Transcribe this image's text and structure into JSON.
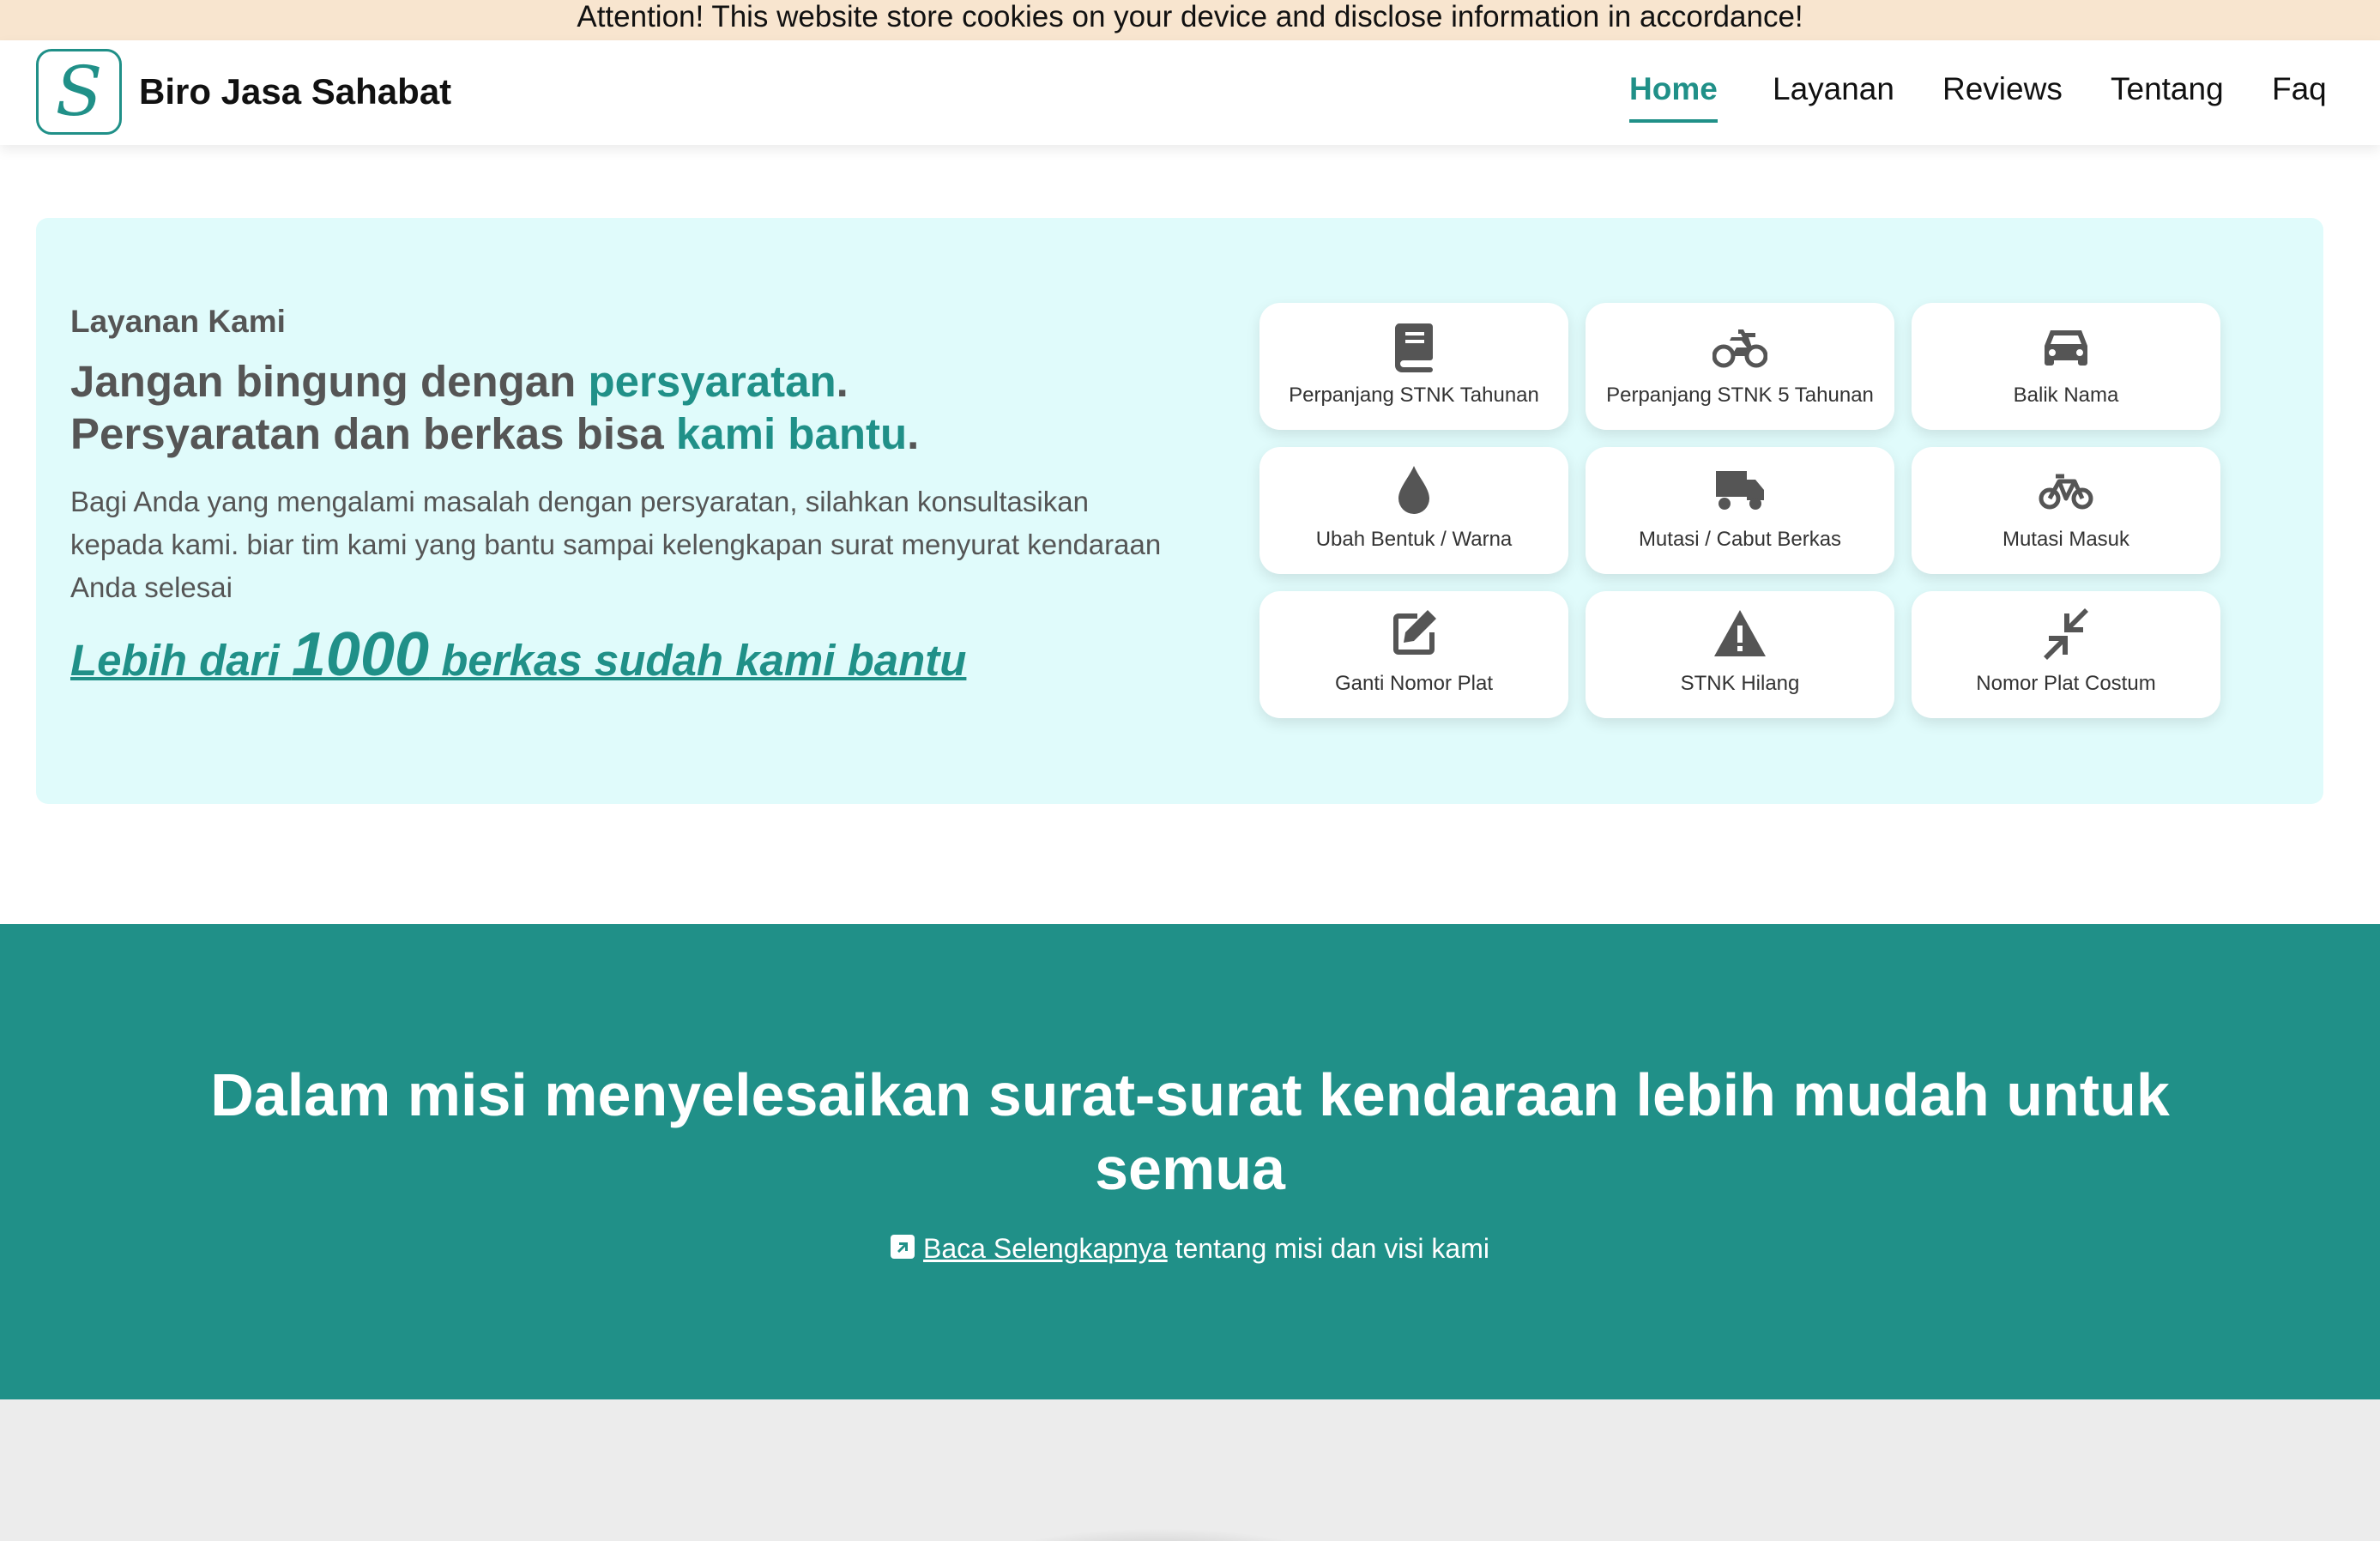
{
  "cookie_banner": {
    "text": "Attention! This website store cookies on your device and disclose information in accordance!"
  },
  "header": {
    "logo_letter": "S",
    "brand": "Biro Jasa Sahabat",
    "nav": [
      {
        "label": "Home",
        "active": true
      },
      {
        "label": "Layanan",
        "active": false
      },
      {
        "label": "Reviews",
        "active": false
      },
      {
        "label": "Tentang",
        "active": false
      },
      {
        "label": "Faq",
        "active": false
      }
    ]
  },
  "hero": {
    "subtitle": "Layanan Kami",
    "title_line1_a": "Jangan bingung dengan ",
    "title_line1_accent": "persyaratan",
    "title_line1_b": ".",
    "title_line2_a": "Persyaratan dan berkas bisa ",
    "title_line2_accent": "kami bantu",
    "title_line2_b": ".",
    "description": "Bagi Anda yang mengalami masalah dengan persyaratan, silahkan konsultasikan kepada kami. biar tim kami yang bantu sampai kelengkapan surat menyurat kendaraan Anda selesai",
    "count_prefix": "Lebih dari ",
    "count_number": "1000",
    "count_suffix": " berkas sudah kami bantu"
  },
  "services": [
    {
      "label": "Perpanjang STNK Tahunan",
      "icon": "book-icon"
    },
    {
      "label": "Perpanjang STNK 5 Tahunan",
      "icon": "motorcycle-icon"
    },
    {
      "label": "Balik Nama",
      "icon": "car-icon"
    },
    {
      "label": "Ubah Bentuk / Warna",
      "icon": "droplet-icon"
    },
    {
      "label": "Mutasi / Cabut Berkas",
      "icon": "truck-icon"
    },
    {
      "label": "Mutasi Masuk",
      "icon": "bicycle-icon"
    },
    {
      "label": "Ganti Nomor Plat",
      "icon": "edit-icon"
    },
    {
      "label": "STNK Hilang",
      "icon": "warning-icon"
    },
    {
      "label": "Nomor Plat Costum",
      "icon": "compress-icon"
    }
  ],
  "mission": {
    "title": "Dalam misi menyelesaikan surat-surat kendaraan lebih mudah untuk semua",
    "link_label": "Baca Selengkapnya",
    "link_suffix": " tentang misi dan visi kami"
  },
  "colors": {
    "accent": "#209088",
    "hero_bg": "#e0fbfb",
    "cookie_bg": "#f8e5cf"
  }
}
